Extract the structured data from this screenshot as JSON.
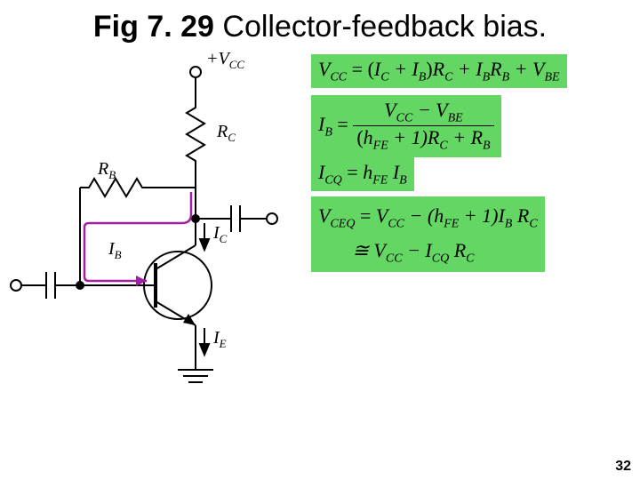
{
  "title": {
    "fig": "Fig 7. 29",
    "rest": " Collector-feedback bias."
  },
  "circuit": {
    "vcc": "+V",
    "vcc_sub": "CC",
    "rc": "R",
    "rc_sub": "C",
    "rb": "R",
    "rb_sub": "B",
    "ib": "I",
    "ib_sub": "B",
    "ic": "I",
    "ic_sub": "C",
    "ie": "I",
    "ie_sub": "E"
  },
  "equations": {
    "eq1_lhs": "V",
    "eq1_lhs_sub": "CC",
    "eq1_eq": " = ",
    "eq1_p1a": "(I",
    "eq1_p1a_sub": "C",
    "eq1_p1b": " + I",
    "eq1_p1b_sub": "B",
    "eq1_p1c": ")R",
    "eq1_p1c_sub": "C",
    "eq1_p2a": " + I",
    "eq1_p2a_sub": "B",
    "eq1_p2b": "R",
    "eq1_p2b_sub": "B",
    "eq1_p3a": " + V",
    "eq1_p3a_sub": "BE",
    "eq2_lhs": "I",
    "eq2_lhs_sub": "B",
    "eq2_eq": " = ",
    "eq2_num_a": "V",
    "eq2_num_a_sub": "CC",
    "eq2_num_b": " − V",
    "eq2_num_b_sub": "BE",
    "eq2_den_a": "(h",
    "eq2_den_a_sub": "FE",
    "eq2_den_b": " + 1)R",
    "eq2_den_b_sub": "C",
    "eq2_den_c": " + R",
    "eq2_den_c_sub": "B",
    "eq3_lhs": "I",
    "eq3_lhs_sub": "CQ",
    "eq3_eq": " = ",
    "eq3_r1": "h",
    "eq3_r1_sub": "FE",
    "eq3_r2": " I",
    "eq3_r2_sub": "B",
    "eq4_lhs": "V",
    "eq4_lhs_sub": "CEQ",
    "eq4_eq": " = ",
    "eq4_r1": "V",
    "eq4_r1_sub": "CC",
    "eq4_r2": " − (h",
    "eq4_r2_sub": "FE",
    "eq4_r3": " + 1)I",
    "eq4_r3_sub": "B",
    "eq4_r4": " R",
    "eq4_r4_sub": "C",
    "eq4_line2_a": "≅ V",
    "eq4_line2_a_sub": "CC",
    "eq4_line2_b": " − I",
    "eq4_line2_b_sub": "CQ",
    "eq4_line2_c": " R",
    "eq4_line2_c_sub": "C"
  },
  "page_number": "32"
}
